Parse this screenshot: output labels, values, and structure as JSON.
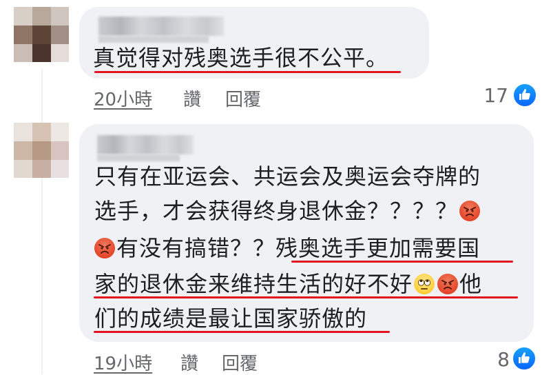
{
  "colors": {
    "bubble_bg": "#eff1f4",
    "underline": "#e3141f",
    "meta_text": "#65676b",
    "like_blue": "#0866ff"
  },
  "comments": [
    {
      "lines": [
        "真觉得对残奥选手很不公平。"
      ],
      "time": "20小時",
      "like_label": "讚",
      "reply_label": "回覆",
      "reaction_count": "17",
      "reaction_icon": "like-icon"
    },
    {
      "lines": [
        "只有在亚运会、共运会及奥运会夺牌的",
        "选手，才会获得终身退休金？？？？",
        "有没有搞错？？残奥选手更加需要国",
        "家的退休金来维持生活的好不好",
        "他",
        "们的成绩是最让国家骄傲的"
      ],
      "emojis": [
        "angry-face-icon",
        "angry-face-icon",
        "eye-roll-face-icon",
        "angry-face-icon"
      ],
      "time": "19小時",
      "like_label": "讚",
      "reply_label": "回覆",
      "reaction_count": "8",
      "reaction_icon": "like-icon"
    }
  ]
}
